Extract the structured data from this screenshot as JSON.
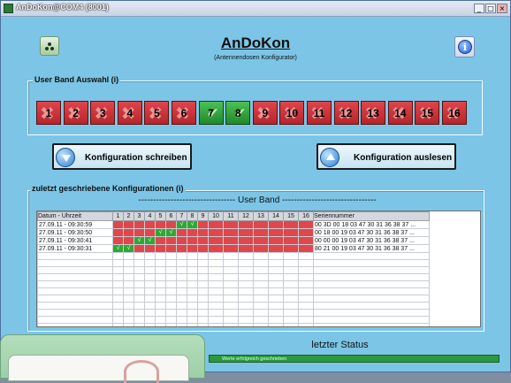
{
  "window": {
    "title": "AnDoKon@COM4 (8001)",
    "min": "_",
    "max": "□",
    "close": "×"
  },
  "app": {
    "title": "AnDoKon",
    "subtitle": "(Antennendosen Konfigurator)",
    "info_label": "i"
  },
  "user_band": {
    "label": "User Band Auswahl (i)",
    "bands": [
      {
        "n": "1",
        "on": false
      },
      {
        "n": "2",
        "on": false
      },
      {
        "n": "3",
        "on": false
      },
      {
        "n": "4",
        "on": false
      },
      {
        "n": "5",
        "on": false
      },
      {
        "n": "6",
        "on": false
      },
      {
        "n": "7",
        "on": true
      },
      {
        "n": "8",
        "on": true
      },
      {
        "n": "9",
        "on": false
      },
      {
        "n": "10",
        "on": false
      },
      {
        "n": "11",
        "on": false
      },
      {
        "n": "12",
        "on": false
      },
      {
        "n": "13",
        "on": false
      },
      {
        "n": "14",
        "on": false
      },
      {
        "n": "15",
        "on": false
      },
      {
        "n": "16",
        "on": false
      }
    ]
  },
  "buttons": {
    "write": "Konfiguration schreiben",
    "read": "Konfiguration auslesen"
  },
  "history": {
    "label": "zuletzt geschriebene Konfigurationen (i)",
    "user_band_header": "--------------------------------- User Band --------------------------------",
    "columns": [
      "Datum - Uhrzeit",
      "1",
      "2",
      "3",
      "4",
      "5",
      "6",
      "7",
      "8",
      "9",
      "10",
      "11",
      "12",
      "13",
      "14",
      "15",
      "16",
      "Seriennummer"
    ],
    "rows": [
      {
        "time": "27.09.11 - 09:30:59",
        "active": [
          7,
          8
        ],
        "serial": "00 3D 00 18 03 47 30 31 36 38 37 ..."
      },
      {
        "time": "27.09.11 - 09:30:50",
        "active": [
          5,
          6
        ],
        "serial": "00 18 00 19 03 47 30 31 36 38 37 ..."
      },
      {
        "time": "27.09.11 - 09:30:41",
        "active": [
          3,
          4
        ],
        "serial": "00 00 00 19 03 47 30 31 36 38 37 ..."
      },
      {
        "time": "27.09.11 - 09:30:31",
        "active": [
          1,
          2
        ],
        "serial": "80 21 00 19 03 47 30 31 36 38 37 ..."
      }
    ],
    "empty_rows": 11,
    "check": "√"
  },
  "status": {
    "label": "letzter Status",
    "message": "Werte erfolgreich geschrieben"
  },
  "colors": {
    "red": "#e0464b",
    "green": "#2ea833",
    "background": "#7cc5e6"
  }
}
